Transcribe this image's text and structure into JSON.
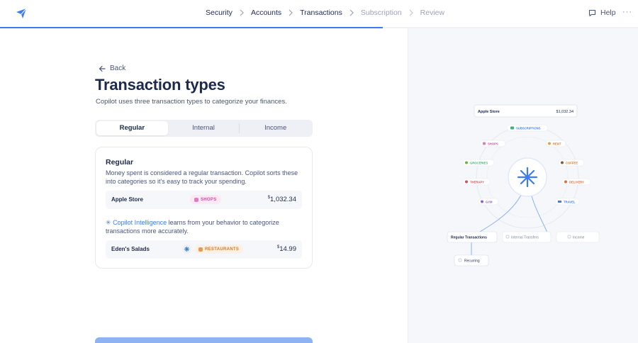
{
  "header": {
    "breadcrumbs": [
      {
        "label": "Security",
        "state": "done"
      },
      {
        "label": "Accounts",
        "state": "done"
      },
      {
        "label": "Transactions",
        "state": "current"
      },
      {
        "label": "Subscription",
        "state": "upcoming"
      },
      {
        "label": "Review",
        "state": "upcoming"
      }
    ],
    "help_label": "Help",
    "more_label": "···",
    "progress": 0.6
  },
  "colors": {
    "accent": "#3d7bf5",
    "text": "#1d2a4d",
    "muted": "#4a5573",
    "shops": "#cc4ea0",
    "restaurants": "#cf7a2c"
  },
  "main": {
    "back_label": "Back",
    "title": "Transaction types",
    "subtitle": "Copilot uses three transaction types to categorize your finances.",
    "tabs": [
      {
        "label": "Regular",
        "active": true
      },
      {
        "label": "Internal",
        "active": false
      },
      {
        "label": "Income",
        "active": false
      }
    ],
    "card": {
      "title": "Regular",
      "description": "Money spent is considered a regular transaction. Copilot sorts these into categories so it's easy to track your spending.",
      "example1": {
        "name": "Apple Store",
        "category": "SHOPS",
        "currency": "$",
        "amount": "1,032.34"
      },
      "intel_highlight": "Copilot Intelligence",
      "intel_rest": " learns from your behavior to categorize transactions more accurately.",
      "example2": {
        "name": "Eden's Salads",
        "category": "RESTAURANTS",
        "currency": "$",
        "amount": "14.99"
      }
    }
  },
  "diagram": {
    "store_card": {
      "name": "Apple Store",
      "amount": "$1,032.34"
    },
    "categories": [
      "SUBSCRIPTIONS",
      "RENT",
      "COFFEE",
      "DELIVERY",
      "TRAVEL",
      "GYM",
      "THERAPY",
      "GROCERIES",
      "SHOPS"
    ],
    "bottom_nodes": [
      "Regular Transactions",
      "Internal Transfers",
      "Income"
    ],
    "recurring_label": "Recurring"
  }
}
